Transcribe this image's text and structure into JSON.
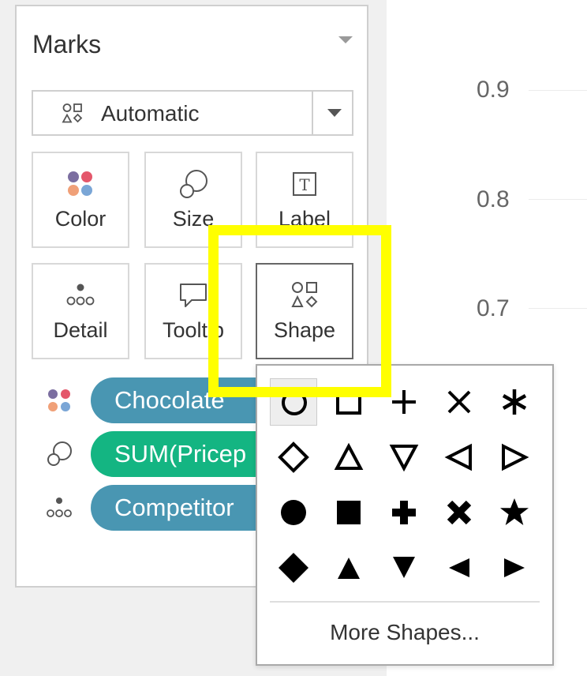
{
  "marks_panel": {
    "title": "Marks",
    "mark_type": {
      "label": "Automatic",
      "icon": "shapes-icon"
    },
    "cards": [
      {
        "id": "color",
        "label": "Color",
        "icon": "color-dots-icon"
      },
      {
        "id": "size",
        "label": "Size",
        "icon": "size-icon"
      },
      {
        "id": "label",
        "label": "Label",
        "icon": "text-label-icon"
      },
      {
        "id": "detail",
        "label": "Detail",
        "icon": "detail-dots-icon"
      },
      {
        "id": "tooltip",
        "label": "Tooltip",
        "icon": "speech-bubble-icon"
      },
      {
        "id": "shape",
        "label": "Shape",
        "icon": "shapes-icon"
      }
    ],
    "pills": [
      {
        "label": "Chocolate",
        "type": "color",
        "color": "#4996b2"
      },
      {
        "label": "SUM(Pricep",
        "type": "size",
        "color": "#14b582"
      },
      {
        "label": "Competitor",
        "type": "detail",
        "color": "#4996b2"
      }
    ]
  },
  "chart_axis": {
    "ticks": [
      "0.9",
      "0.8",
      "0.7"
    ]
  },
  "shape_palette": {
    "rows": [
      [
        "open-circle",
        "open-square",
        "plus",
        "cross",
        "asterisk"
      ],
      [
        "open-diamond",
        "open-triangle-up",
        "open-triangle-down",
        "open-triangle-left",
        "open-triangle-right"
      ],
      [
        "filled-circle",
        "filled-square",
        "filled-plus",
        "filled-cross",
        "filled-star"
      ],
      [
        "filled-diamond",
        "filled-triangle-up",
        "filled-triangle-down",
        "filled-triangle-left",
        "filled-triangle-right"
      ]
    ],
    "selected": "open-circle",
    "more_label": "More Shapes..."
  },
  "highlight": {
    "color": "#ffff00",
    "target": "shape"
  },
  "colors": {
    "swatch_purple": "#7b6ea0",
    "swatch_red": "#e4576b",
    "swatch_orange": "#f0a078",
    "swatch_blue": "#7aa6d6"
  }
}
